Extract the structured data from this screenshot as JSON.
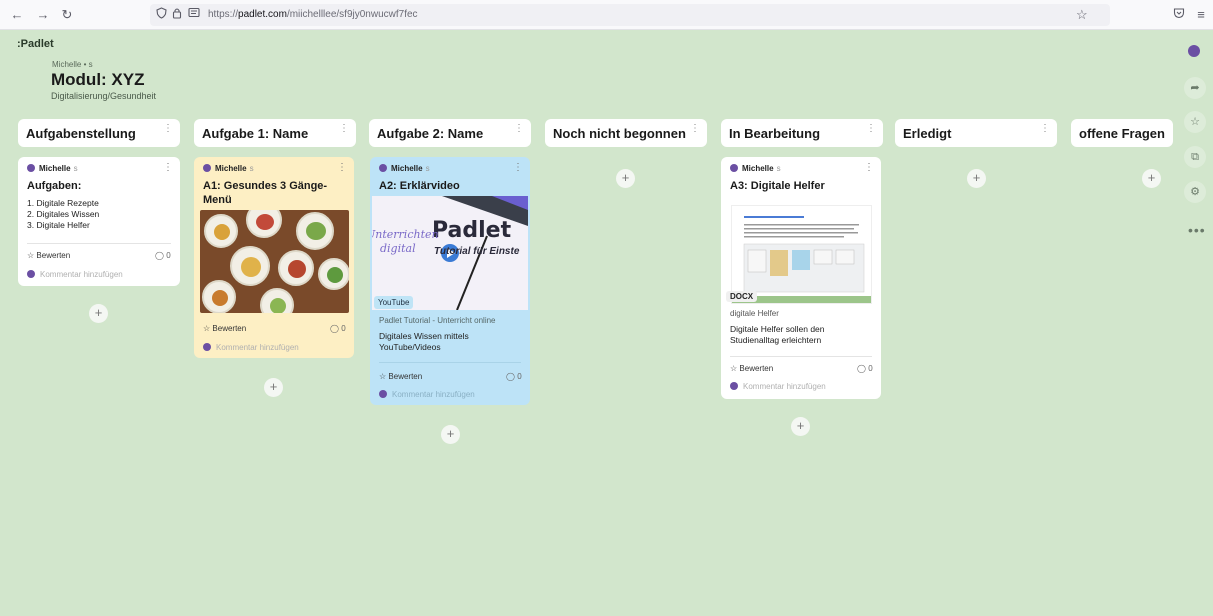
{
  "browser": {
    "url_prefix": "https://",
    "url_domain": "padlet.com",
    "url_path": "/miichelllee/sf9jy0nwucwf7fec"
  },
  "header": {
    "logo": ":Padlet",
    "owner": "Michelle • s",
    "title": "Modul: XYZ",
    "subtitle": "Digitalisierung/Gesundheit"
  },
  "columns": [
    {
      "label": "Aufgabenstellung"
    },
    {
      "label": "Aufgabe 1: Name"
    },
    {
      "label": "Aufgabe 2: Name"
    },
    {
      "label": "Noch nicht begonnen"
    },
    {
      "label": "In Bearbeitung"
    },
    {
      "label": "Erledigt"
    },
    {
      "label": "offene Fragen"
    }
  ],
  "common": {
    "author": "Michelle",
    "author_suffix": "s",
    "rate": "Bewerten",
    "count": "0",
    "comment": "Kommentar hinzufügen",
    "plus": "+"
  },
  "cards": {
    "c1": {
      "title": "Aufgaben:",
      "lines": [
        "1. Digitale Rezepte",
        "2. Digitales Wissen",
        "3. Digitale Helfer"
      ]
    },
    "c2": {
      "title_l1": "A1: Gesundes 3 Gänge-",
      "title_l2": "Menü"
    },
    "c3": {
      "title": "A2: Erklärvideo",
      "thumb_brand": "Padlet",
      "thumb_sub": "Tutorial für Einste",
      "thumb_handwrite1": "Unterrichten",
      "thumb_handwrite2": "digital",
      "source_tag": "YouTube",
      "link_title": "Padlet Tutorial - Unterricht online",
      "desc_l1": "Digitales Wissen mittels",
      "desc_l2": "YouTube/Videos"
    },
    "c4": {
      "title": "A3: Digitale Helfer",
      "file_tag": "DOCX",
      "file_name": "digitale Helfer",
      "desc_l1": "Digitale Helfer sollen den",
      "desc_l2": "Studienalltag erleichtern"
    }
  },
  "colors": {
    "background": "#d2e6cc",
    "card_yellow": "#fdefc4",
    "card_blue": "#bde3f7",
    "avatar": "#6b4fa3"
  }
}
